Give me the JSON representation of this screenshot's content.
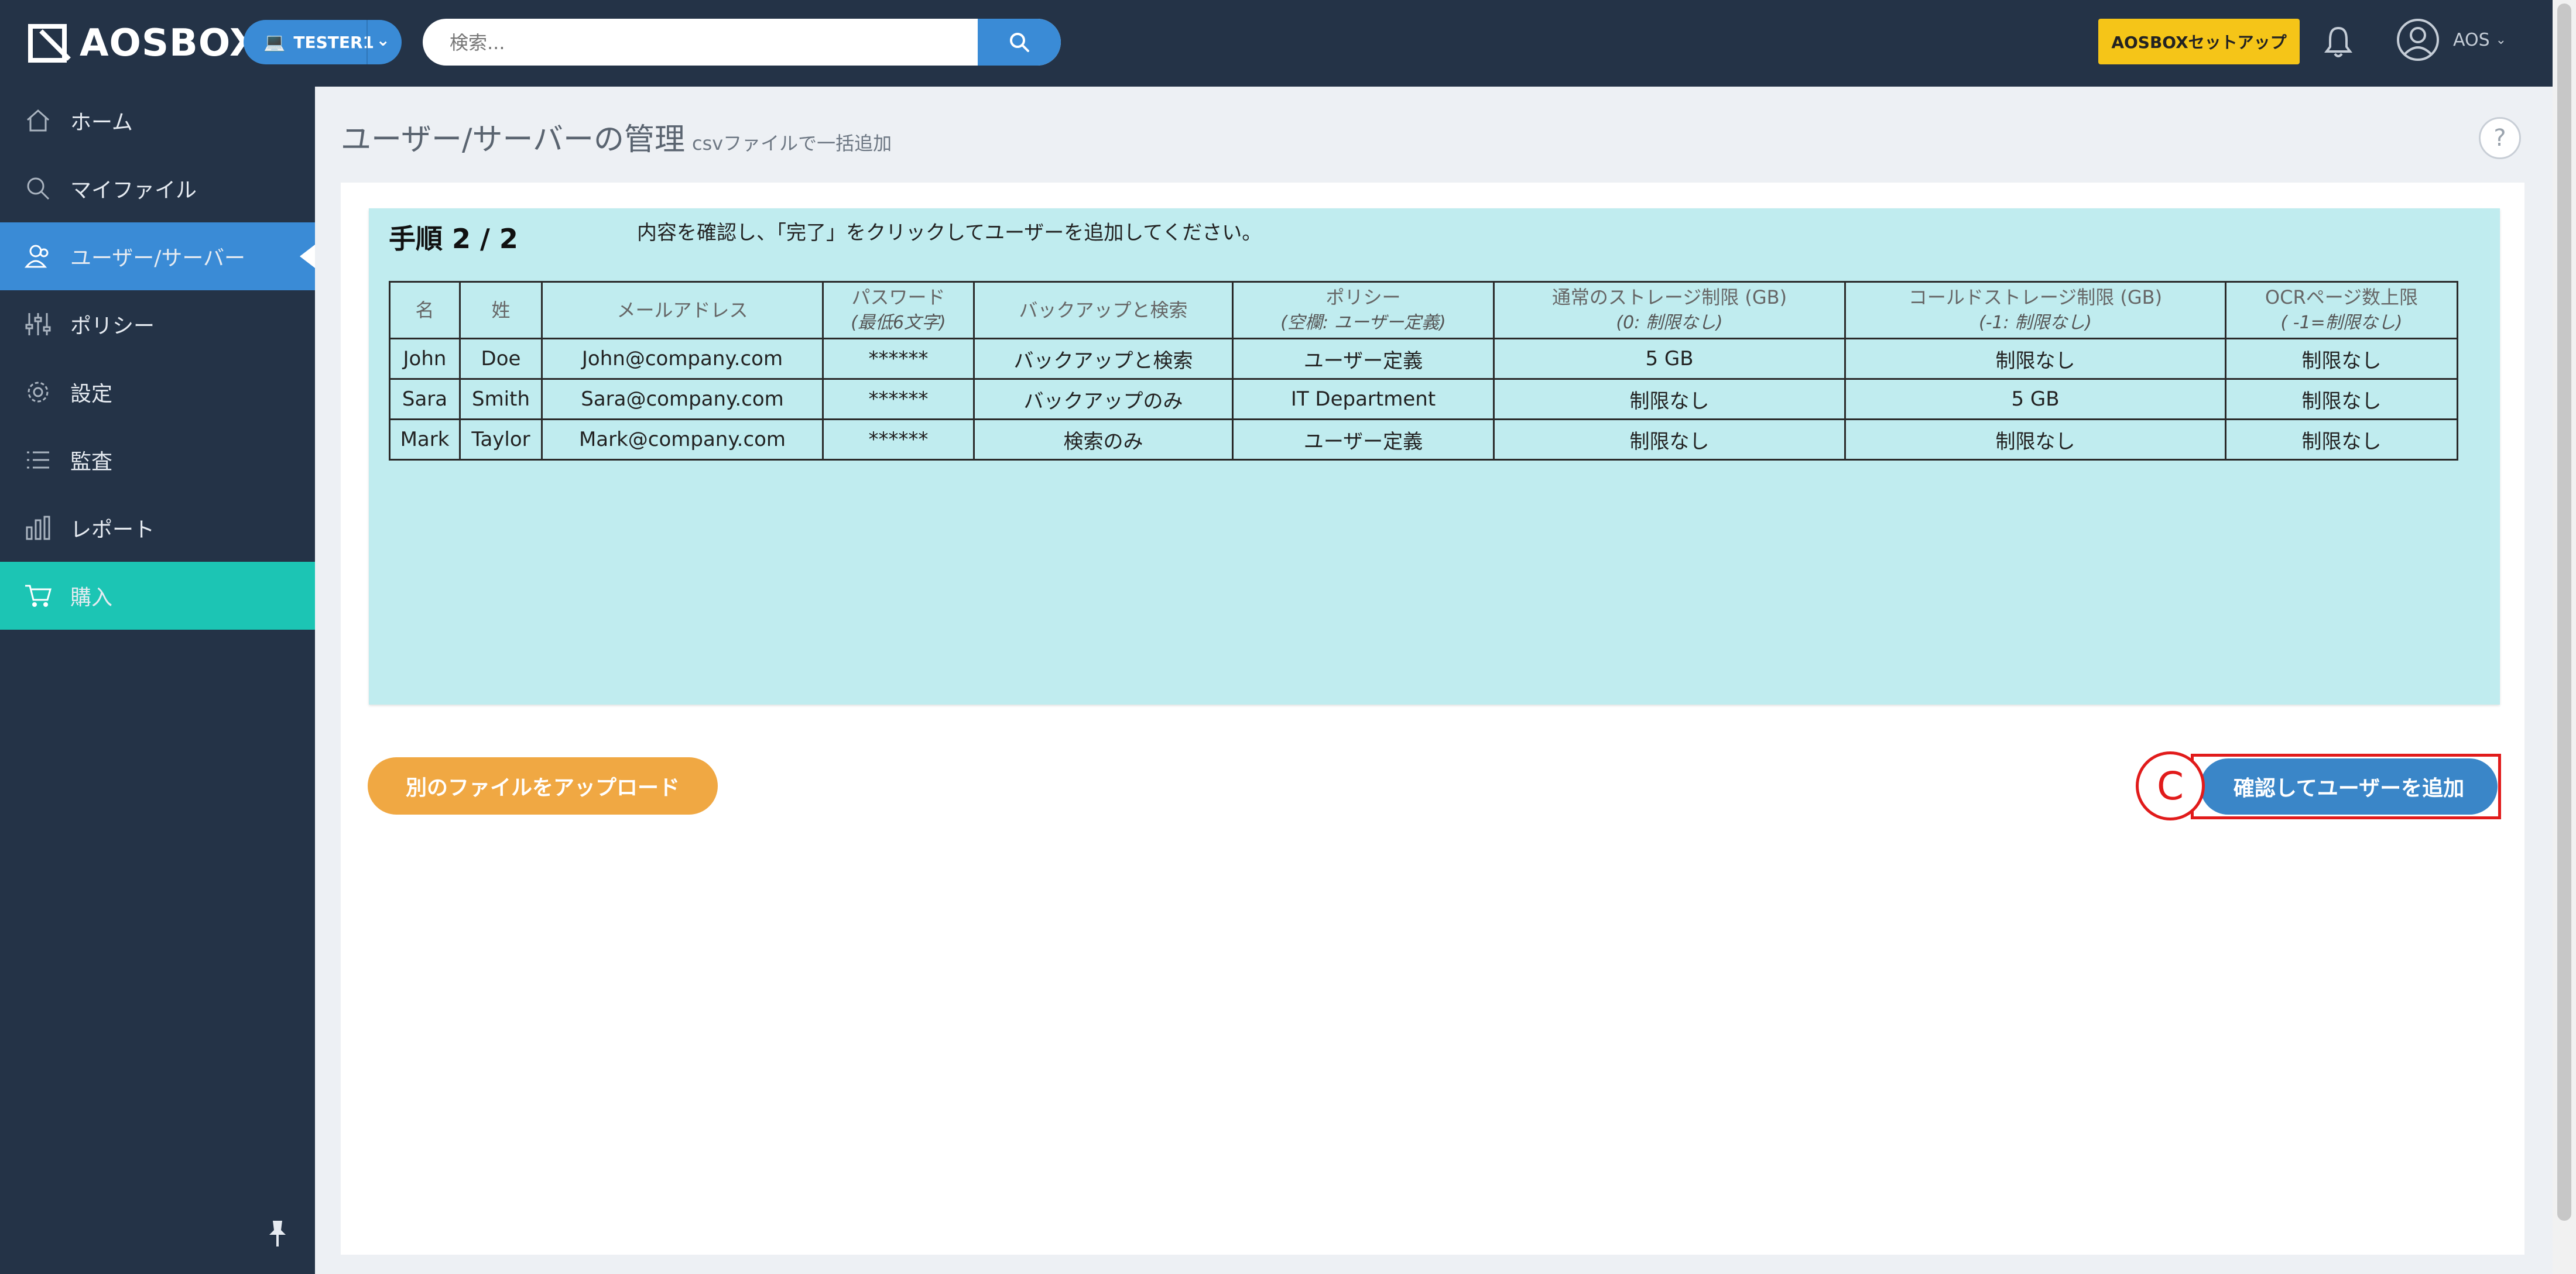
{
  "app": {
    "logo_text": "AOSBOX",
    "tenant_label": "TESTER1"
  },
  "search": {
    "placeholder": "検索..."
  },
  "header": {
    "setup_button": "AOSBOXセットアップ",
    "user_name": "AOS"
  },
  "sidebar": {
    "items": [
      {
        "label": "ホーム",
        "icon": "home-icon"
      },
      {
        "label": "マイファイル",
        "icon": "search-icon"
      },
      {
        "label": "ユーザー/サーバー",
        "icon": "users-icon"
      },
      {
        "label": "ポリシー",
        "icon": "sliders-icon"
      },
      {
        "label": "設定",
        "icon": "gear-icon"
      },
      {
        "label": "監査",
        "icon": "list-icon"
      },
      {
        "label": "レポート",
        "icon": "bar-chart-icon"
      },
      {
        "label": "購入",
        "icon": "cart-icon"
      }
    ]
  },
  "page": {
    "title": "ユーザー/サーバーの管理",
    "subtitle": "csvファイルで一括追加"
  },
  "wizard": {
    "step": "手順 2 / 2",
    "instruction": "内容を確認し、「完了」をクリックしてユーザーを追加してください。"
  },
  "table": {
    "headers": [
      {
        "main": "名",
        "hint": ""
      },
      {
        "main": "姓",
        "hint": ""
      },
      {
        "main": "メールアドレス",
        "hint": ""
      },
      {
        "main": "パスワード",
        "hint": "(最低6文字)"
      },
      {
        "main": "バックアップと検索",
        "hint": ""
      },
      {
        "main": "ポリシー",
        "hint": "(空欄: ユーザー定義)"
      },
      {
        "main": "通常のストレージ制限 (GB)",
        "hint": "(0: 制限なし)"
      },
      {
        "main": "コールドストレージ制限 (GB)",
        "hint": "(-1: 制限なし)"
      },
      {
        "main": "OCRページ数上限",
        "hint": "( -1=制限なし)"
      }
    ],
    "rows": [
      [
        "John",
        "Doe",
        "John@company.com",
        "******",
        "バックアップと検索",
        "ユーザー定義",
        "5 GB",
        "制限なし",
        "制限なし"
      ],
      [
        "Sara",
        "Smith",
        "Sara@company.com",
        "******",
        "バックアップのみ",
        "IT Department",
        "制限なし",
        "5 GB",
        "制限なし"
      ],
      [
        "Mark",
        "Taylor",
        "Mark@company.com",
        "******",
        "検索のみ",
        "ユーザー定義",
        "制限なし",
        "制限なし",
        "制限なし"
      ]
    ]
  },
  "actions": {
    "upload_other": "別のファイルをアップロード",
    "confirm_add": "確認してユーザーを追加"
  },
  "annotation": {
    "marker": "C"
  },
  "colors": {
    "navy": "#243347",
    "accent_blue": "#3a8bd6",
    "teal": "#1cc5b4",
    "yellow": "#f5c518",
    "orange": "#f0a843",
    "panel": "#c0ecef",
    "marker_red": "#e11b1b"
  }
}
